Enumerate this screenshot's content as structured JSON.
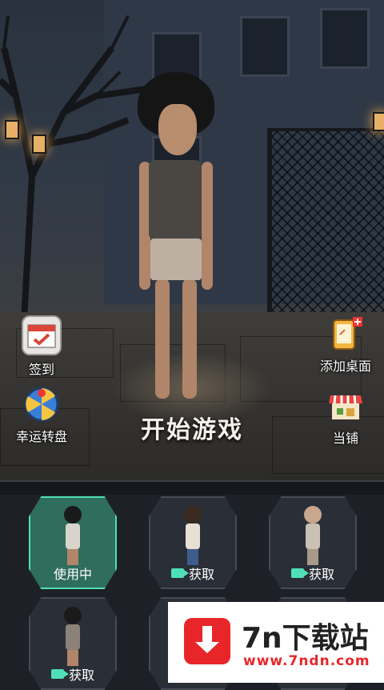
{
  "side_buttons": {
    "checkin": {
      "label": "签到",
      "icon": "calendar-check-icon"
    },
    "wheel": {
      "label": "幸运转盘",
      "icon": "lucky-wheel-icon"
    },
    "add_desktop": {
      "label": "添加桌面",
      "icon": "phone-plus-icon"
    },
    "shop": {
      "label": "当铺",
      "icon": "shop-awning-icon"
    }
  },
  "start_button": {
    "label": "开始游戏"
  },
  "skins": [
    {
      "status": "使用中",
      "active": true
    },
    {
      "status": "获取",
      "active": false,
      "icon": "video-icon"
    },
    {
      "status": "获取",
      "active": false,
      "icon": "video-icon"
    },
    {
      "status": "获取",
      "active": false,
      "icon": "video-icon"
    }
  ],
  "watermark": {
    "brand": "7n下载站",
    "url": "www.7ndn.com"
  },
  "colors": {
    "accent": "#4fe0b8",
    "active_card": "#2f6d5c",
    "watermark_red": "#e8262a"
  }
}
